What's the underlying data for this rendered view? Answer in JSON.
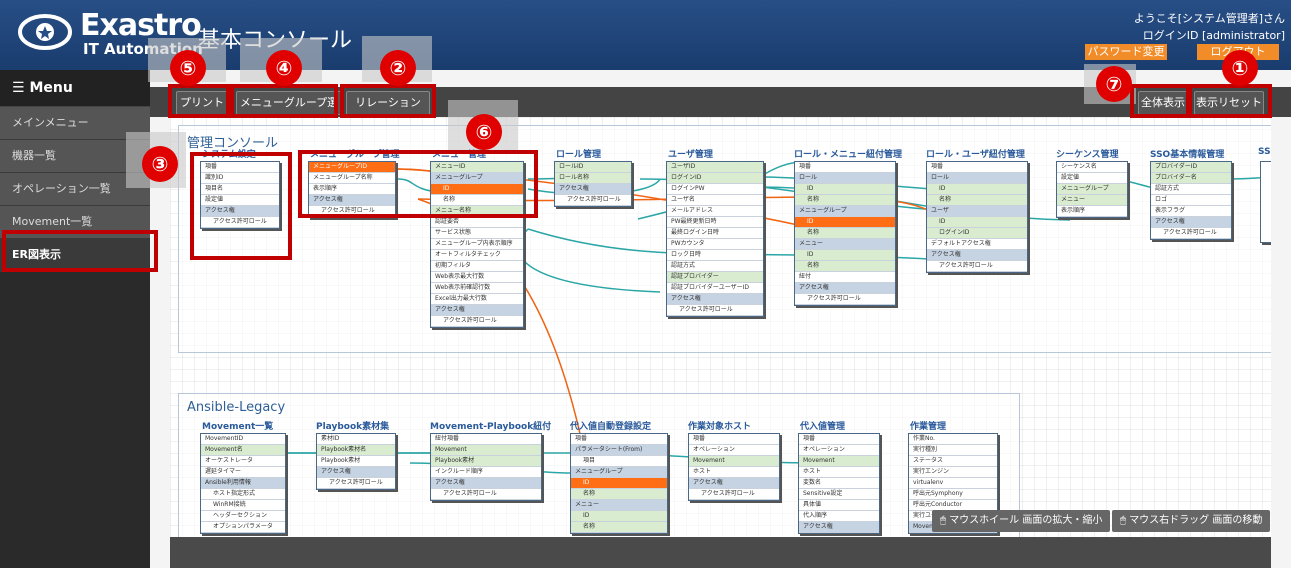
{
  "header": {
    "logo_main": "Exastro",
    "logo_sub": "IT Automation",
    "app_title": "基本コンソール",
    "welcome": "ようこそ[システム管理者]さん",
    "login_id": "ログインID [administrator]",
    "password_change": "パスワード変更",
    "logout": "ログアウト"
  },
  "sidebar": {
    "title": "Menu",
    "items": [
      {
        "label": "メインメニュー"
      },
      {
        "label": "機器一覧"
      },
      {
        "label": "オペレーション一覧"
      },
      {
        "label": "Movement一覧"
      },
      {
        "label": "ER図表示"
      }
    ]
  },
  "toolbar": {
    "print": "プリント",
    "menu_group_select": "メニューグループ選択",
    "relation": "リレーション",
    "relation_check": "✔",
    "show_all": "全体表示",
    "reset_view": "表示リセット"
  },
  "groups": {
    "console": "管理コンソール",
    "ansible": "Ansible-Legacy"
  },
  "tables": {
    "t1": {
      "title": "システム設定",
      "rows": [
        "項番",
        "識別ID",
        "項目名",
        "設定値",
        "アクセス権",
        "アクセス許可ロール"
      ]
    },
    "t2": {
      "title": "メニューグループ管理",
      "rows": [
        "メニューグループID",
        "メニューグループ名称",
        "表示順序",
        "アクセス権",
        "アクセス許可ロール"
      ]
    },
    "t3": {
      "title": "メニュー管理",
      "rows": [
        "メニューID",
        "メニューグループ",
        "ID",
        "名称",
        "メニュー名称",
        "認証要否",
        "サービス状態",
        "メニューグループ内表示順序",
        "オートフィルタチェック",
        "初期フィルタ",
        "Web表示最大行数",
        "Web表示前確認行数",
        "Excel出力最大行数",
        "アクセス権",
        "アクセス許可ロール"
      ]
    },
    "t4": {
      "title": "ロール管理",
      "rows": [
        "ロールID",
        "ロール名称",
        "アクセス権",
        "アクセス許可ロール"
      ]
    },
    "t5": {
      "title": "ユーザ管理",
      "rows": [
        "ユーザID",
        "ログインID",
        "ログインPW",
        "ユーザ名",
        "メールアドレス",
        "PW最終更新日時",
        "最終ログイン日時",
        "PWカウンタ",
        "ロック日時",
        "認証方式",
        "認証プロバイダー",
        "認証プロバイダーユーザーID",
        "アクセス権",
        "アクセス許可ロール"
      ]
    },
    "t6": {
      "title": "ロール・メニュー紐付管理",
      "rows": [
        "項番",
        "ロール",
        "ID",
        "名称",
        "メニューグループ",
        "ID",
        "名称",
        "メニュー",
        "ID",
        "名称",
        "紐付",
        "アクセス権",
        "アクセス許可ロール"
      ]
    },
    "t7": {
      "title": "ロール・ユーザ紐付管理",
      "rows": [
        "項番",
        "ロール",
        "ID",
        "名称",
        "ユーザ",
        "ID",
        "ログインID",
        "デフォルトアクセス権",
        "アクセス権",
        "アクセス許可ロール"
      ]
    },
    "t8": {
      "title": "シーケンス管理",
      "rows": [
        "シーケンス名",
        "設定値",
        "メニューグループ",
        "メニュー",
        "表示順序"
      ]
    },
    "t9": {
      "title": "SSO基本情報管理",
      "rows": [
        "プロバイダーID",
        "プロバイダー名",
        "認証方式",
        "ロゴ",
        "表示フラグ",
        "アクセス権",
        "アクセス許可ロール"
      ]
    },
    "t9b": {
      "title": "SSO"
    },
    "a1": {
      "title": "Movement一覧",
      "rows": [
        "MovementID",
        "Movement名",
        "オーケストレータ",
        "遅延タイマー",
        "Ansible利用情報",
        "ホスト指定形式",
        "WinRM接続",
        "ヘッダーセクション",
        "オプションパラメータ"
      ]
    },
    "a2": {
      "title": "Playbook素材集",
      "rows": [
        "素材ID",
        "Playbook素材名",
        "Playbook素材",
        "アクセス権",
        "アクセス許可ロール"
      ]
    },
    "a3": {
      "title": "Movement-Playbook紐付",
      "rows": [
        "紐付項番",
        "Movement",
        "Playbook素材",
        "インクルード順序",
        "アクセス権",
        "アクセス許可ロール"
      ]
    },
    "a4": {
      "title": "代入値自動登録設定",
      "rows": [
        "項番",
        "パラメータシート(From)",
        "項目",
        "メニューグループ",
        "ID",
        "名称",
        "メニュー",
        "ID",
        "名称"
      ]
    },
    "a5": {
      "title": "作業対象ホスト",
      "rows": [
        "項番",
        "オペレーション",
        "Movement",
        "ホスト",
        "アクセス権",
        "アクセス許可ロール"
      ]
    },
    "a6": {
      "title": "代入値管理",
      "rows": [
        "項番",
        "オペレーション",
        "Movement",
        "ホスト",
        "変数名",
        "Sensitive設定",
        "具体値",
        "代入順序",
        "アクセス権"
      ]
    },
    "a7": {
      "title": "作業管理",
      "rows": [
        "作業No.",
        "実行種別",
        "ステータス",
        "実行エンジン",
        "virtualenv",
        "呼出元Symphony",
        "呼出元Conductor",
        "実行ユーザ",
        "Movement"
      ]
    }
  },
  "markers": [
    "①",
    "②",
    "③",
    "④",
    "⑤",
    "⑥",
    "⑦"
  ],
  "hints": {
    "wheel": "マウスホイール 画面の拡大・縮小",
    "drag": "マウス右ドラッグ 画面の移動"
  },
  "colors": {
    "accent": "#f28c28",
    "highlight": "#ff6e14",
    "key": "#d9ecd0",
    "marker": "#e00000",
    "relation_line": "#2aa6a6"
  }
}
